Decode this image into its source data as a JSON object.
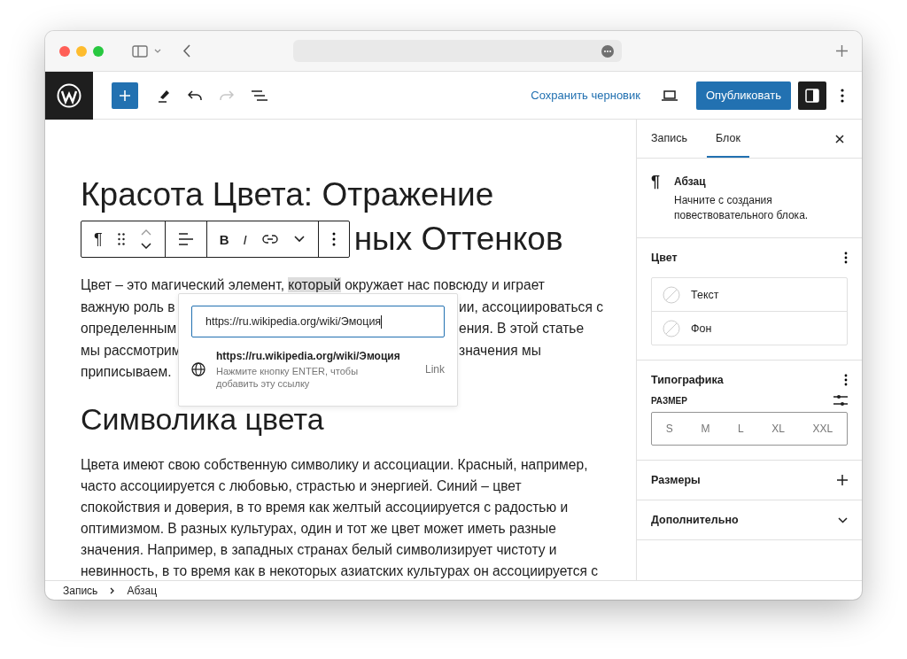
{
  "header": {
    "tools": [
      {
        "kind": "add",
        "disabled": false
      },
      {
        "kind": "pen",
        "disabled": false
      },
      {
        "kind": "undo",
        "disabled": false
      },
      {
        "kind": "redo",
        "disabled": true
      },
      {
        "kind": "list",
        "disabled": false
      }
    ],
    "save_draft": "Сохранить черновик",
    "publish": "Опубликовать",
    "settings_open": true
  },
  "editor": {
    "title_first_line": "Красота Цвета: Отражение",
    "title_visible_tail": "ных Оттенков",
    "block_toolbar": [
      [
        {
          "kind": "paragraph",
          "label": "¶"
        },
        {
          "kind": "drag"
        },
        {
          "kind": "move"
        }
      ],
      [
        {
          "kind": "align"
        }
      ],
      [
        {
          "kind": "bold",
          "label": "B"
        },
        {
          "kind": "italic",
          "label": "I"
        },
        {
          "kind": "link"
        },
        {
          "kind": "more"
        }
      ],
      [
        {
          "kind": "options"
        }
      ]
    ],
    "paragraph_first_line": {
      "before": "Цвет – это магический элемент,",
      "highlight": "который",
      "after": "окружает нас повсюду и играет"
    },
    "paragraph_lines": [
      {
        "left": "важную роль в",
        "right": "ии, ассоциироваться с"
      },
      {
        "left": "определенным",
        "right": "ения. В этой статье"
      },
      {
        "left": "мы рассмотрим",
        "right": "значения мы"
      },
      {
        "left": "приписываем."
      }
    ],
    "link_popup": {
      "url": "https://ru.wikipedia.org/wiki/Эмоция",
      "suggestion_title": "https://ru.wikipedia.org/wiki/Эмоция",
      "suggestion_hint": "Нажмите кнопку ENTER, чтобы добавить эту ссылку",
      "suggestion_type": "Link"
    },
    "subheading": "Символика цвета",
    "paragraph2_lines": [
      "Цвета имеют свою собственную символику и ассоциации. Красный, например,",
      "часто ассоциируется с любовью, страстью и энергией. Синий – цвет",
      "спокойствия и доверия, в то время как желтый ассоциируется с радостью и",
      "оптимизмом. В разных культурах, один и тот же цвет может иметь разные",
      "значения. Например, в западных странах белый символизирует чистоту и",
      "невинность, в то время как в некоторых азиатских культурах он ассоциируется с"
    ]
  },
  "breadcrumbs": [
    "Запись",
    "Абзац"
  ],
  "sidebar": {
    "tabs": [
      {
        "label": "Запись",
        "selected": false
      },
      {
        "label": "Блок",
        "selected": true
      }
    ],
    "block": {
      "icon": "¶",
      "name": "Абзац",
      "description": "Начните с создания повествовательного блока."
    },
    "panels": [
      {
        "kind": "color",
        "title": "Цвет",
        "items": [
          "Текст",
          "Фон"
        ]
      },
      {
        "kind": "typography",
        "title": "Типографика",
        "size_label": "РАЗМЕР",
        "sizes": [
          {
            "label": "S",
            "selected": false
          },
          {
            "label": "M",
            "selected": false
          },
          {
            "label": "L",
            "selected": false
          },
          {
            "label": "XL",
            "selected": false
          },
          {
            "label": "XXL",
            "selected": false
          }
        ]
      },
      {
        "kind": "add",
        "title": "Размеры"
      },
      {
        "kind": "expand",
        "title": "Дополнительно",
        "expanded": false
      }
    ]
  }
}
